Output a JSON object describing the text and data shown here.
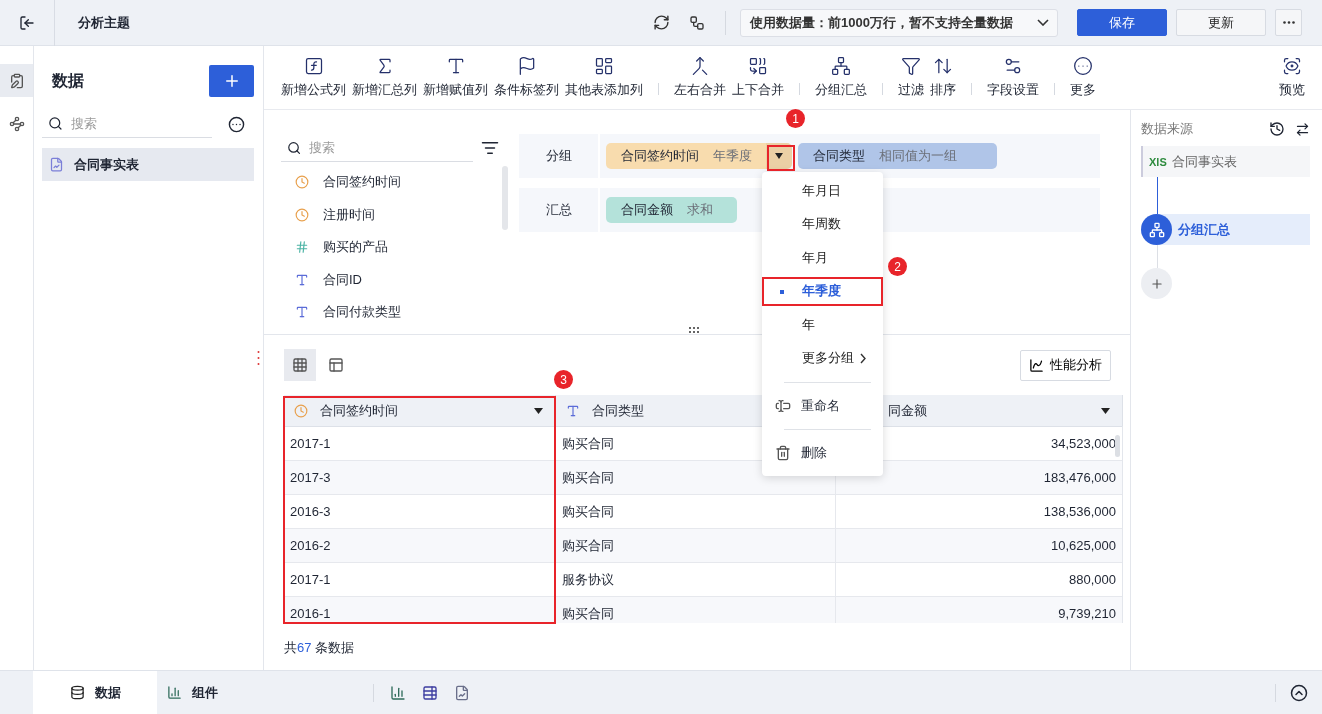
{
  "topbar": {
    "title": "分析主题",
    "data_limit": "使用数据量：前1000万行，暂不支持全量数据",
    "buttons": [
      {
        "label": "保存",
        "kind": "primary"
      },
      {
        "label": "更新",
        "kind": "default"
      }
    ]
  },
  "data_panel": {
    "title": "数据",
    "search": {
      "placeholder": "搜索"
    },
    "tables": [
      {
        "label": "合同事实表",
        "selected": true
      }
    ]
  },
  "toolbar": {
    "groups": [
      [
        "新增公式列",
        "新增汇总列",
        "新增赋值列",
        "条件标签列",
        "其他表添加列"
      ],
      [
        "左右合并",
        "上下合并"
      ],
      [
        "分组汇总"
      ],
      [
        "过滤",
        "排序"
      ],
      [
        "字段设置"
      ],
      [
        "更多"
      ]
    ],
    "preview": "预览"
  },
  "fields": {
    "search": {
      "placeholder": "搜索"
    },
    "items": [
      {
        "label": "合同签约时间",
        "kind": "date"
      },
      {
        "label": "注册时间",
        "kind": "date"
      },
      {
        "label": "购买的产品",
        "kind": "number"
      },
      {
        "label": "合同ID",
        "kind": "text"
      },
      {
        "label": "合同付款类型",
        "kind": "text"
      }
    ]
  },
  "group_config": {
    "rows": [
      {
        "label": "分组",
        "pills": [
          {
            "name": "合同签约时间",
            "detail": "年季度",
            "color": "#f8dcae",
            "has_menu": true
          },
          {
            "name": "合同类型",
            "detail": "相同值为一组",
            "color": "#b0c5e8",
            "has_menu": false
          }
        ]
      },
      {
        "label": "汇总",
        "pills": [
          {
            "name": "合同金额",
            "detail": "求和",
            "color": "#b4e2da",
            "has_menu": false
          }
        ]
      }
    ]
  },
  "dropdown_menu": {
    "options": [
      {
        "label": "年月日",
        "selected": false
      },
      {
        "label": "年周数",
        "selected": false
      },
      {
        "label": "年月",
        "selected": false
      },
      {
        "label": "年季度",
        "selected": true
      },
      {
        "label": "年",
        "selected": false
      }
    ],
    "submenu": "更多分组",
    "actions": [
      "重命名",
      "删除"
    ]
  },
  "view_toggle": [
    {
      "selected": true
    },
    {
      "selected": false
    }
  ],
  "performance_button": "性能分析",
  "table": {
    "columns": [
      {
        "label": "合同签约时间",
        "kind": "date"
      },
      {
        "label": "合同类型",
        "kind": "text"
      },
      {
        "label": "同金额"
      }
    ],
    "rows": [
      [
        "2017-1",
        "购买合同",
        "34,523,000"
      ],
      [
        "2017-3",
        "购买合同",
        "183,476,000"
      ],
      [
        "2016-3",
        "购买合同",
        "138,536,000"
      ],
      [
        "2016-2",
        "购买合同",
        "10,625,000"
      ],
      [
        "2017-1",
        "服务协议",
        "880,000"
      ],
      [
        "2016-1",
        "购买合同",
        "9,739,210"
      ]
    ],
    "footer": {
      "prefix": "共",
      "count": "67",
      "suffix": "条数据"
    }
  },
  "flow": {
    "title": "数据来源",
    "source_badge": "XlS",
    "nodes": [
      {
        "label": "合同事实表",
        "kind": "source",
        "selected": false
      },
      {
        "label": "分组汇总",
        "kind": "step",
        "selected": true
      }
    ]
  },
  "bottom_tabs": [
    {
      "label": "数据",
      "selected": true
    },
    {
      "label": "组件",
      "selected": false
    }
  ],
  "annotations": [
    {
      "label": "1"
    },
    {
      "label": "2"
    },
    {
      "label": "3"
    }
  ]
}
